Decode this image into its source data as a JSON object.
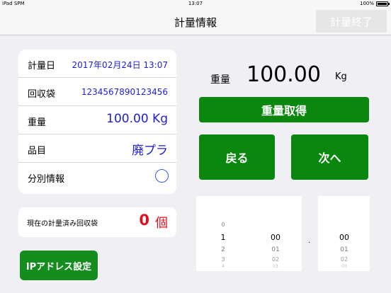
{
  "status_bar": {
    "device": "iPad",
    "network": "SPM",
    "time": "13:07",
    "battery": "100%"
  },
  "nav": {
    "title": "計量情報",
    "end_button": "計量終了"
  },
  "info": {
    "date_label": "計量日",
    "date_value": "2017年02月24日 13:07",
    "bag_label": "回収袋",
    "bag_value": "1234567890123456",
    "weight_label": "重量",
    "weight_value": "100.00 Kg",
    "item_label": "品目",
    "item_value": "廃プラ",
    "sort_label": "分別情報"
  },
  "count": {
    "label": "現在の計量済み回収袋",
    "value": "0",
    "unit": "個"
  },
  "ip_button": "IPアドレス設定",
  "weight_display": {
    "label": "重量",
    "value": "100.00",
    "unit": "Kg"
  },
  "buttons": {
    "get": "重量取得",
    "back": "戻る",
    "next": "次へ"
  },
  "picker": {
    "col1": [
      "0",
      "1",
      "2",
      "3",
      "4"
    ],
    "col2": [
      "00",
      "01",
      "02",
      "03"
    ],
    "col3": [
      "00",
      "01",
      "02",
      "03"
    ],
    "separator": "."
  },
  "colors": {
    "accent_green": "#0a870f",
    "blue_text": "#1e1ed8",
    "red_text": "#e0111e"
  }
}
